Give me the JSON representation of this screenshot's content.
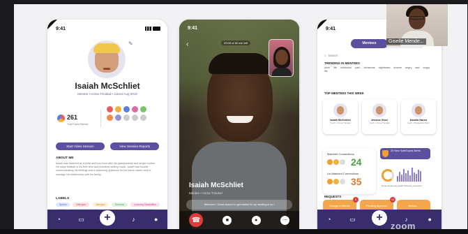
{
  "zoom": {
    "participant_name": "Giselle Mende...",
    "watermark": "zoom"
  },
  "profile_screen": {
    "time": "9:41",
    "name": "Isaiah McSchliet",
    "subtitle": "Mentee • Arima Trinidad • Joined Aug 2019",
    "points": "261",
    "points_label": "Total Points Earned",
    "badge_colors": [
      "#e85d5d",
      "#f3b13c",
      "#5a7fe0",
      "#e26aa0",
      "#7ac36a",
      "#f28b4a",
      "#9b8fd6",
      "#ccc",
      "#ccc",
      "#ccc"
    ],
    "buttons": [
      "Start Video Session",
      "View Session Reports"
    ],
    "about_heading": "ABOUT ME",
    "about_text": "Isaiah was fostered as a child and now lives with his grandparents and single mother. He plays football in his free time and practices writing music. Isaiah has trouble communicating his feelings and is searching guidance for his future career and to manage his relationship with his family.",
    "labels_heading": "LABELS",
    "labels": [
      {
        "text": "Sports",
        "bg": "#dfe7fb",
        "fg": "#4b6fd6"
      },
      {
        "text": "Allergies",
        "bg": "#fbe2e2",
        "fg": "#d24b4b"
      },
      {
        "text": "Allergies",
        "bg": "#fdf0d6",
        "fg": "#d19027"
      },
      {
        "text": "Eczema",
        "bg": "#e2f4e0",
        "fg": "#4a9e44"
      },
      {
        "text": "Learning Disabilities",
        "bg": "#fbe2ef",
        "fg": "#c94a86"
      },
      {
        "text": "Shy",
        "bg": "#e6e3f7",
        "fg": "#6b5fa8"
      },
      {
        "text": "Parent with Disability",
        "bg": "#dfe7fb",
        "fg": "#4b6fd6"
      },
      {
        "text": "Opinionated",
        "bg": "#fdf0d6",
        "fg": "#d19027"
      },
      {
        "text": "Introverted Learner",
        "bg": "#e2f4e0",
        "fg": "#4a9e44"
      }
    ]
  },
  "call_screen": {
    "time": "9:41",
    "timer": "03:05 of 60 min left",
    "caller_name": "Isaiah McSchliet",
    "caller_sub": "Mentee • Arima Trinidad",
    "caption": "Welcome ! Great chance to get started to my meeting is so !"
  },
  "mentees_screen": {
    "time": "9:41",
    "tabs": [
      "Mentees",
      "Se..."
    ],
    "search_placeholder": "Search",
    "trending_heading": "TRENDING IN MENTEES",
    "trending": [
      "work",
      "life",
      "confusion",
      "pain",
      "christmas",
      "nightmare",
      "shame",
      "angry",
      "sad",
      "angry",
      "life"
    ],
    "top_heading": "TOP MENTEES THIS WEEK",
    "top_mentees": [
      {
        "name": "Isaiah McSchliet",
        "meta": "Youth • Arima Trinidad"
      },
      {
        "name": "Jessica Vivor",
        "meta": "Youth • Arima Trinidad"
      },
      {
        "name": "Kamila Harris",
        "meta": "Youth • Bridgetown Barb."
      }
    ],
    "matched_label": "Matched Connections",
    "matched_value": "24",
    "unmatched_label": "Un-Matched Connections",
    "unmatched_value": "35",
    "alerts_title": "20 New SafeGuard Alerts",
    "alerts_legend": "Regional Mental Health Wellness Indicators",
    "requests_heading": "REQUESTS",
    "requests": [
      {
        "label": "Change in Mentor",
        "count": "8"
      },
      {
        "label": "Pending Approval",
        "count": "14"
      },
      {
        "label": "Mentor...",
        "count": ""
      }
    ]
  }
}
